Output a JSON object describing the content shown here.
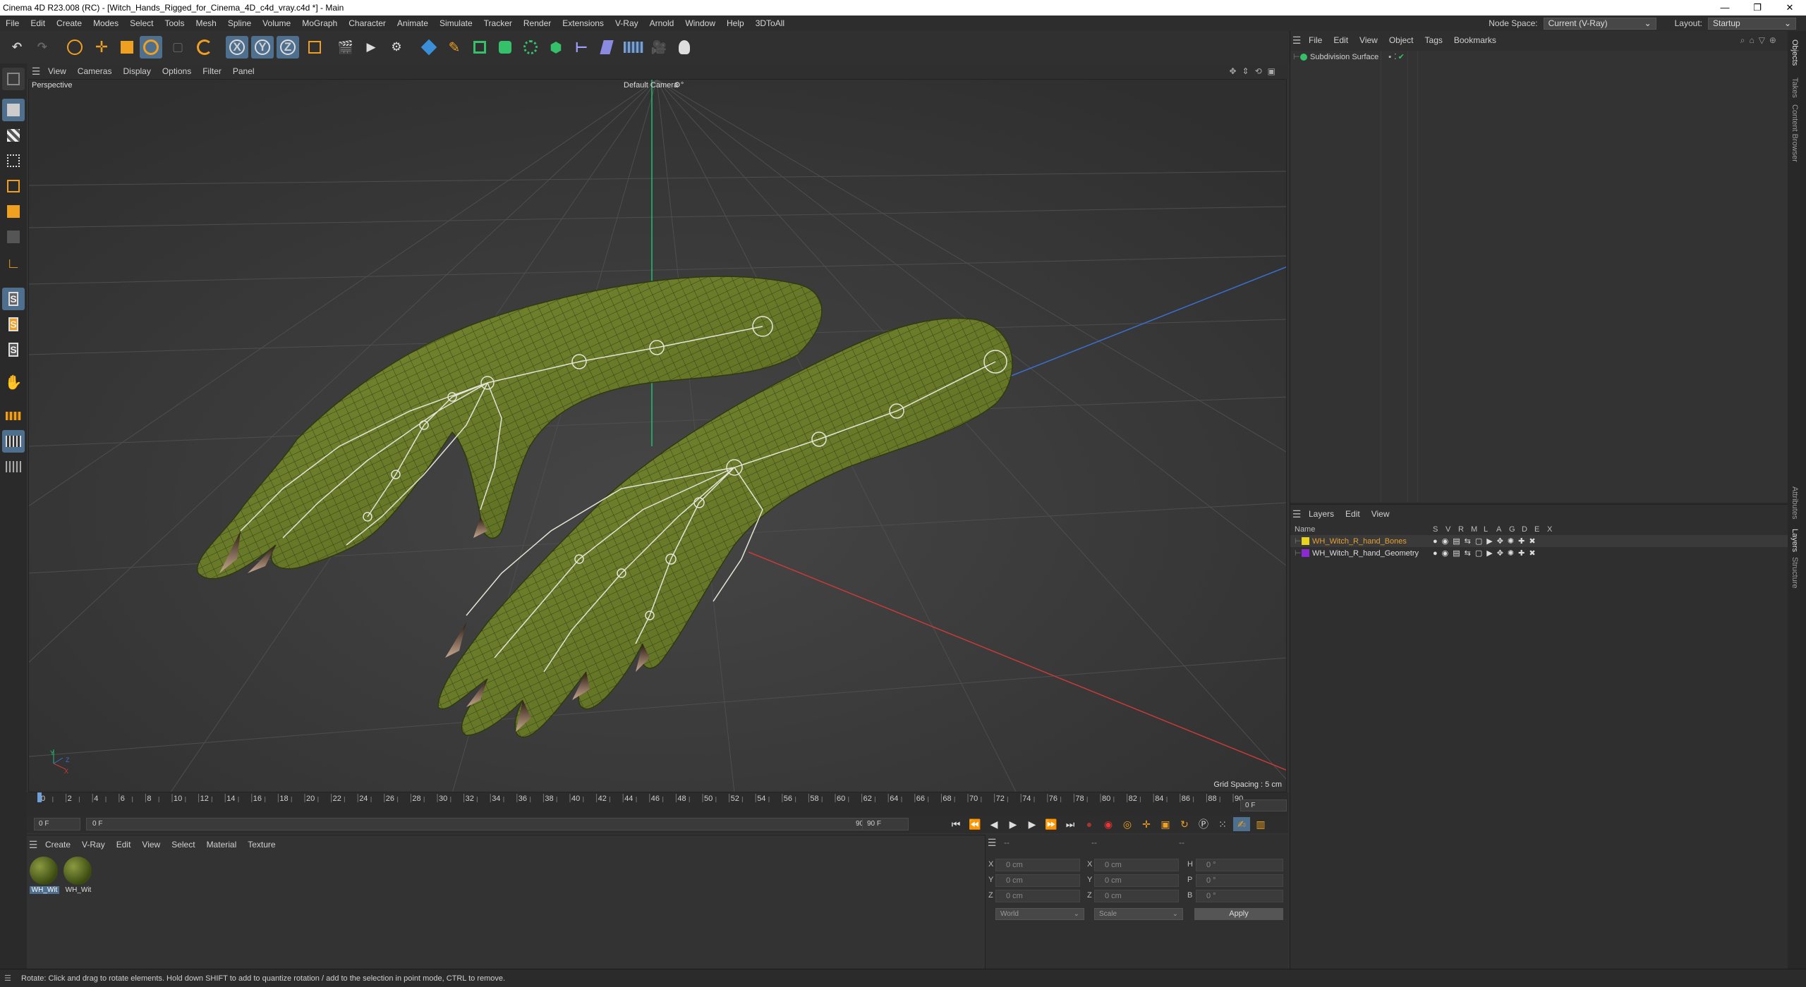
{
  "window": {
    "title": "Cinema 4D R23.008 (RC) - [Witch_Hands_Rigged_for_Cinema_4D_c4d_vray.c4d *] - Main",
    "controls": [
      "—",
      "❐",
      "✕"
    ]
  },
  "menubar": {
    "items": [
      "File",
      "Edit",
      "Create",
      "Modes",
      "Select",
      "Tools",
      "Mesh",
      "Spline",
      "Volume",
      "MoGraph",
      "Character",
      "Animate",
      "Simulate",
      "Tracker",
      "Render",
      "Extensions",
      "V-Ray",
      "Arnold",
      "Window",
      "Help",
      "3DToAll"
    ],
    "node_space_label": "Node Space:",
    "node_space_value": "Current (V-Ray)",
    "layout_label": "Layout:",
    "layout_value": "Startup"
  },
  "toolbar": {
    "axis_x": "X",
    "axis_y": "Y",
    "axis_z": "Z"
  },
  "viewport": {
    "menu": [
      "View",
      "Cameras",
      "Display",
      "Options",
      "Filter",
      "Panel"
    ],
    "view_name": "Perspective",
    "camera_name": "Default Camera",
    "grid_spacing": "Grid Spacing : 5 cm",
    "axis_labels": {
      "y": "Y",
      "z": "Z",
      "x": "X"
    }
  },
  "timeline": {
    "ticks": [
      "0",
      "2",
      "4",
      "6",
      "8",
      "10",
      "12",
      "14",
      "16",
      "18",
      "20",
      "22",
      "24",
      "26",
      "28",
      "30",
      "32",
      "34",
      "36",
      "38",
      "40",
      "42",
      "44",
      "46",
      "48",
      "50",
      "52",
      "54",
      "56",
      "58",
      "60",
      "62",
      "64",
      "66",
      "68",
      "70",
      "72",
      "74",
      "76",
      "78",
      "80",
      "82",
      "84",
      "86",
      "88",
      "90"
    ],
    "current_frame_field": "0 F",
    "current": 0,
    "start_field": "0 F",
    "range_start": "0 F",
    "range_end": "90 F",
    "end_field": "90 F"
  },
  "materials": {
    "menu": [
      "Create",
      "V-Ray",
      "Edit",
      "View",
      "Select",
      "Material",
      "Texture"
    ],
    "items": [
      {
        "label": "WH_Wit"
      },
      {
        "label": "WH_Wit"
      }
    ]
  },
  "coords": {
    "rows": [
      {
        "a": "X",
        "av": "0 cm",
        "b": "X",
        "bv": "0 cm",
        "c": "H",
        "cv": "0 °"
      },
      {
        "a": "Y",
        "av": "0 cm",
        "b": "Y",
        "bv": "0 cm",
        "c": "P",
        "cv": "0 °"
      },
      {
        "a": "Z",
        "av": "0 cm",
        "b": "Z",
        "bv": "0 cm",
        "c": "B",
        "cv": "0 °"
      }
    ],
    "header_dashes": [
      "--",
      "--",
      "--"
    ],
    "coord_system": "World",
    "mode": "Scale",
    "apply": "Apply"
  },
  "objects_panel": {
    "menu": [
      "File",
      "Edit",
      "View",
      "Object",
      "Tags",
      "Bookmarks"
    ],
    "objects": [
      {
        "name": "Subdivision Surface"
      }
    ]
  },
  "layers_panel": {
    "menu": [
      "Layers",
      "Edit",
      "View"
    ],
    "header_name": "Name",
    "columns": [
      "S",
      "V",
      "R",
      "M",
      "L",
      "A",
      "G",
      "D",
      "E",
      "X"
    ],
    "rows": [
      {
        "name": "WH_Witch_R_hand_Bones",
        "color": "#e6d21f",
        "highlight": true
      },
      {
        "name": "WH_Witch_R_hand_Geometry",
        "color": "#8a2ad0",
        "highlight": false
      }
    ]
  },
  "side_tabs": [
    "Objects",
    "Takes",
    "Content Browser",
    "Attributes",
    "Layers",
    "Structure"
  ],
  "statusbar": {
    "text": "Rotate: Click and drag to rotate elements. Hold down SHIFT to add to quantize rotation / add to the selection in point mode, CTRL to remove."
  },
  "colors": {
    "accent_orange": "#f0a020",
    "selection_blue": "#4f6f8f",
    "skin_green": "#6e7f2c"
  }
}
